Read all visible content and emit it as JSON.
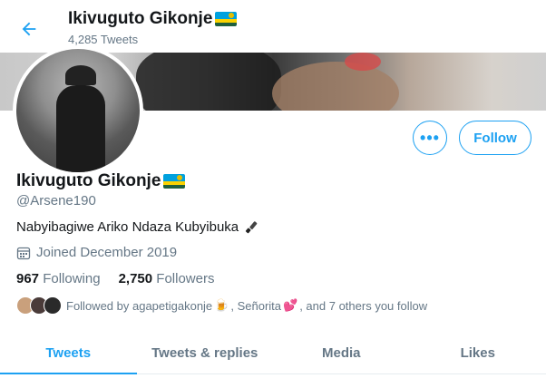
{
  "header": {
    "back_icon": "arrow-left-icon",
    "name": "Ikivuguto Gikonje",
    "tweet_count": "4,285 Tweets"
  },
  "profile": {
    "name": "Ikivuguto Gikonje",
    "handle": "@Arsene190",
    "bio": "Nabyibagiwe Ariko Ndaza Kubyibuka",
    "joined": "Joined December 2019",
    "following_count": "967",
    "following_label": "Following",
    "followers_count": "2,750",
    "followers_label": "Followers",
    "followed_by": {
      "prefix": "Followed by agapetigakonje",
      "emoji1": "🍺",
      "middle": ", Señorita",
      "emoji2": "💕",
      "suffix": ", and 7 others you follow"
    }
  },
  "actions": {
    "more_label": "•••",
    "follow_label": "Follow"
  },
  "tabs": [
    {
      "label": "Tweets",
      "active": true
    },
    {
      "label": "Tweets & replies",
      "active": false
    },
    {
      "label": "Media",
      "active": false
    },
    {
      "label": "Likes",
      "active": false
    }
  ],
  "colors": {
    "accent": "#1da1f2",
    "muted_text": "#657786",
    "primary_text": "#14171a"
  }
}
